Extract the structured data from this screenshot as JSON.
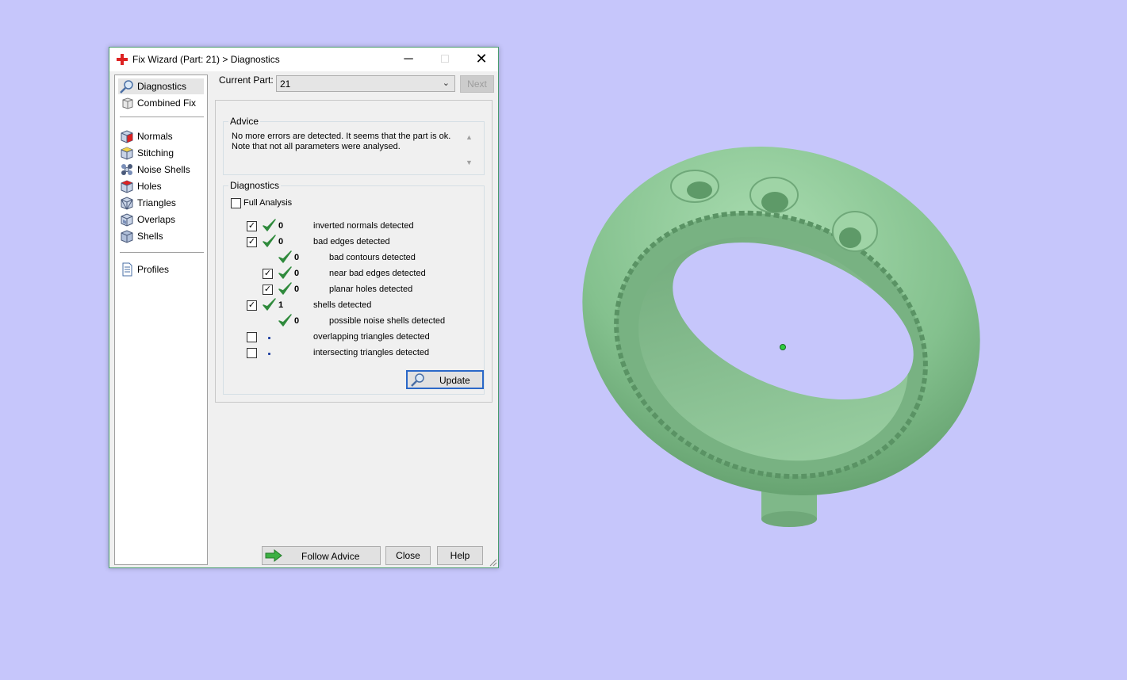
{
  "window": {
    "title": "Fix Wizard (Part: 21) > Diagnostics",
    "controls": {
      "minimize": "─",
      "maximize": "□",
      "close": "✕"
    }
  },
  "sidebar": {
    "items": [
      {
        "label": "Diagnostics",
        "icon": "magnifier-icon",
        "selected": true
      },
      {
        "label": "Combined Fix",
        "icon": "combined-fix-icon"
      },
      {
        "label": "Normals",
        "icon": "normals-cube-icon"
      },
      {
        "label": "Stitching",
        "icon": "stitching-cube-icon"
      },
      {
        "label": "Noise Shells",
        "icon": "noise-shells-icon"
      },
      {
        "label": "Holes",
        "icon": "holes-cube-icon"
      },
      {
        "label": "Triangles",
        "icon": "triangles-cube-icon"
      },
      {
        "label": "Overlaps",
        "icon": "overlaps-cube-icon"
      },
      {
        "label": "Shells",
        "icon": "shells-cube-icon"
      },
      {
        "label": "Profiles",
        "icon": "profiles-document-icon"
      }
    ]
  },
  "header": {
    "current_part_label": "Current Part:",
    "current_part_value": "21",
    "next_label": "Next"
  },
  "advice": {
    "title": "Advice",
    "text": "No more errors are detected. It seems that the part is ok.\nNote that not all parameters were analysed."
  },
  "diagnostics": {
    "title": "Diagnostics",
    "full_analysis_label": "Full Analysis",
    "full_analysis_checked": false,
    "rows": [
      {
        "checkbox": true,
        "checked": true,
        "status": "ok",
        "count": "0",
        "label": "inverted normals detected"
      },
      {
        "checkbox": true,
        "checked": true,
        "status": "ok",
        "count": "0",
        "label": "bad edges detected"
      },
      {
        "checkbox": false,
        "status": "ok",
        "count": "0",
        "label": "bad contours detected"
      },
      {
        "checkbox": true,
        "checked": true,
        "status": "ok",
        "count": "0",
        "label": "near bad edges detected"
      },
      {
        "checkbox": true,
        "checked": true,
        "status": "ok",
        "count": "0",
        "label": "planar holes detected"
      },
      {
        "checkbox": true,
        "checked": true,
        "status": "ok",
        "count": "1",
        "label": "shells detected"
      },
      {
        "checkbox": false,
        "status": "ok",
        "count": "0",
        "label": "possible noise shells detected"
      },
      {
        "checkbox": true,
        "checked": false,
        "status": "pending",
        "count": "",
        "label": "overlapping triangles detected"
      },
      {
        "checkbox": true,
        "checked": false,
        "status": "pending",
        "count": "",
        "label": "intersecting triangles detected"
      }
    ],
    "update_label": "Update"
  },
  "footer": {
    "follow_advice_label": "Follow Advice",
    "close_label": "Close",
    "help_label": "Help"
  },
  "colors": {
    "background": "#c6c6fb",
    "model": "#8fcc98",
    "check_green": "#2f8a3c",
    "accent_blue": "#2a68c8"
  }
}
